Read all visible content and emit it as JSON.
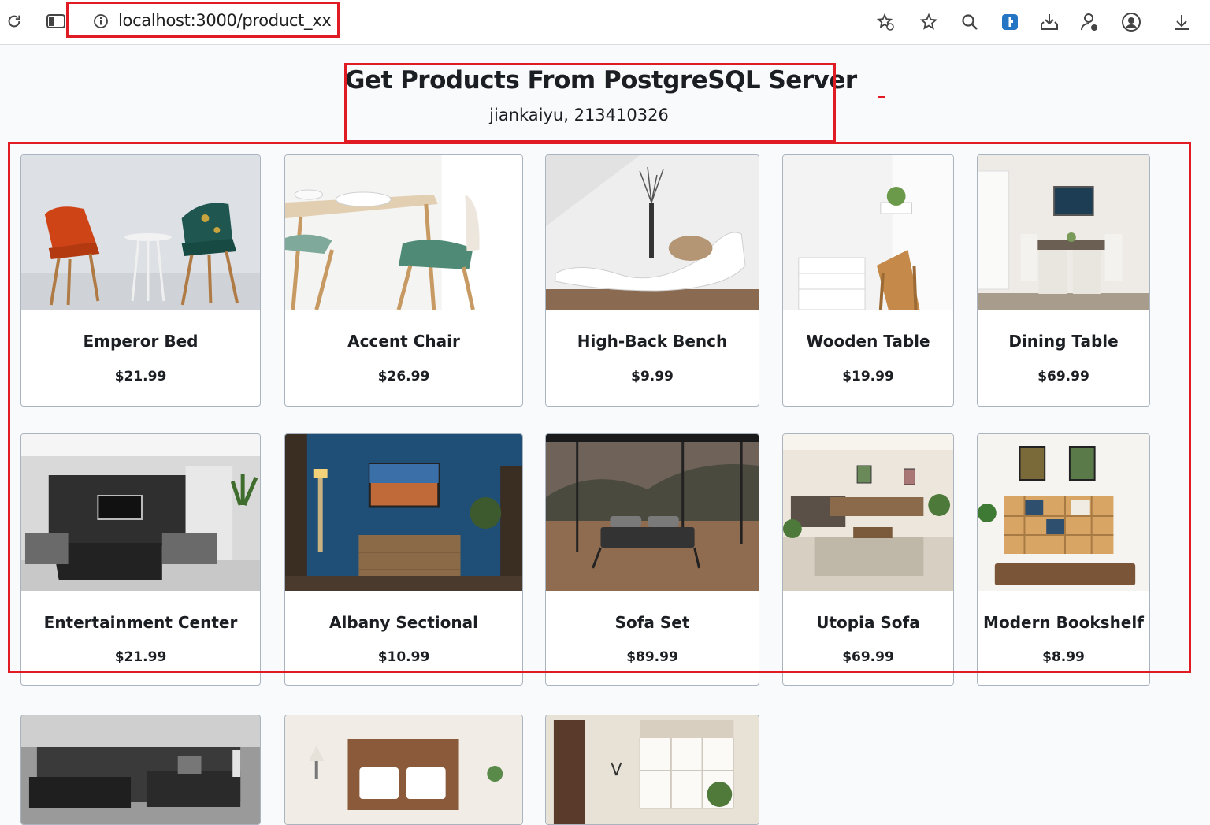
{
  "browser": {
    "url": "localhost:3000/product_xx",
    "icons": [
      "reload-icon",
      "sidebar-icon",
      "info-icon",
      "extensions-star-icon",
      "bookmark-star-icon",
      "search-icon",
      "extension-icon",
      "download-to-drive-icon",
      "profile-key-icon",
      "account-icon",
      "downloads-icon"
    ]
  },
  "header": {
    "title": "Get Products From PostgreSQL Server",
    "subtitle": "jiankaiyu, 213410326"
  },
  "colors": {
    "annotation": "#e01b24",
    "page_background": "#f9fafc",
    "card_border": "#aab4c0"
  },
  "products": [
    {
      "name": "Emperor Bed",
      "price": "$21.99"
    },
    {
      "name": "Accent Chair",
      "price": "$26.99"
    },
    {
      "name": "High-Back Bench",
      "price": "$9.99"
    },
    {
      "name": "Wooden Table",
      "price": "$19.99"
    },
    {
      "name": "Dining Table",
      "price": "$69.99"
    },
    {
      "name": "Entertainment Center",
      "price": "$21.99"
    },
    {
      "name": "Albany Sectional",
      "price": "$10.99"
    },
    {
      "name": "Sofa Set",
      "price": "$89.99"
    },
    {
      "name": "Utopia Sofa",
      "price": "$69.99"
    },
    {
      "name": "Modern Bookshelf",
      "price": "$8.99"
    }
  ]
}
